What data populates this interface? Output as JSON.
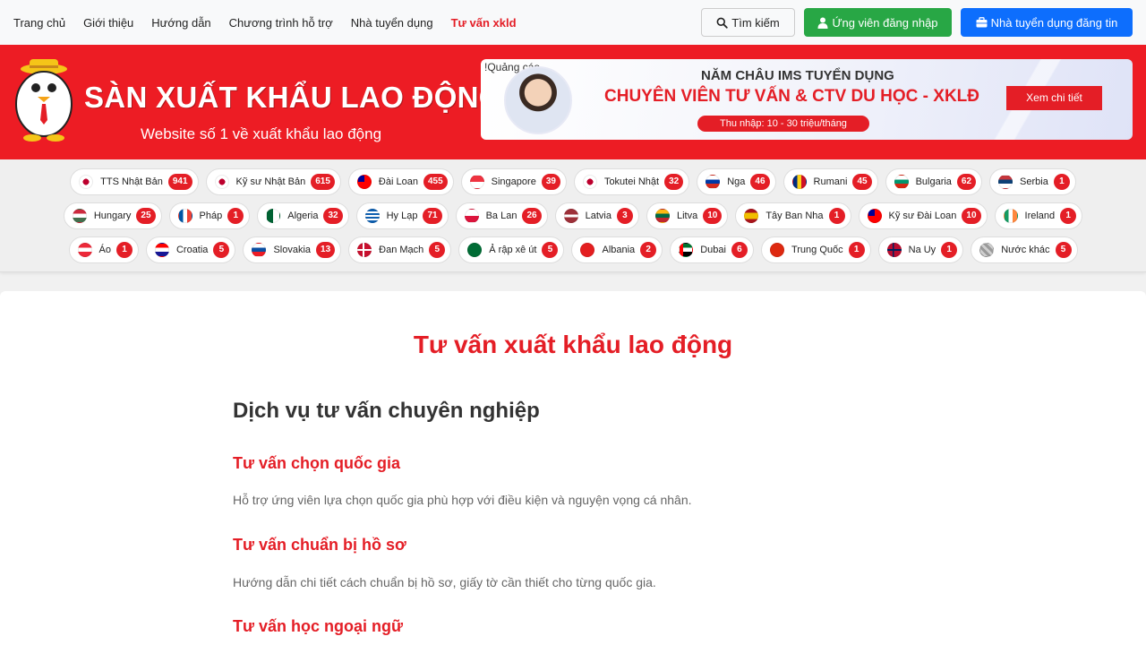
{
  "nav": {
    "links": [
      "Trang chủ",
      "Giới thiệu",
      "Hướng dẫn",
      "Chương trình hỗ trợ",
      "Nhà tuyển dụng",
      "Tư vấn xkld"
    ],
    "search_label": "Tìm kiếm",
    "candidate_login_label": "Ứng viên đăng nhập",
    "employer_post_label": "Nhà tuyển dụng đăng tin"
  },
  "brand": {
    "logo_text": "SÀN XUẤT KHẨU LAO ĐỘNG .COM",
    "tagline": "Website số 1 về xuất khẩu lao động",
    "primary_color": "#e41e26"
  },
  "ad": {
    "label": "!Quảng cáo",
    "title1": "NĂM CHÂU IMS TUYỂN DỤNG",
    "title2": "CHUYÊN VIÊN TƯ VẤN & CTV DU HỌC - XKLĐ",
    "income": "Thu nhập: 10 - 30 triệu/tháng",
    "cta": "Xem chi tiết"
  },
  "countries": [
    [
      {
        "name": "TTS Nhật Bản",
        "count": "941",
        "flag": "jp"
      },
      {
        "name": "Kỹ sư Nhật Bản",
        "count": "615",
        "flag": "jp"
      },
      {
        "name": "Đài Loan",
        "count": "455",
        "flag": "tw"
      },
      {
        "name": "Singapore",
        "count": "39",
        "flag": "sg"
      },
      {
        "name": "Tokutei Nhật",
        "count": "32",
        "flag": "jp"
      },
      {
        "name": "Nga",
        "count": "46",
        "flag": "ru"
      },
      {
        "name": "Rumani",
        "count": "45",
        "flag": "ro"
      },
      {
        "name": "Bulgaria",
        "count": "62",
        "flag": "bg"
      },
      {
        "name": "Serbia",
        "count": "1",
        "flag": "rs"
      }
    ],
    [
      {
        "name": "Hungary",
        "count": "25",
        "flag": "hu"
      },
      {
        "name": "Pháp",
        "count": "1",
        "flag": "fr"
      },
      {
        "name": "Algeria",
        "count": "32",
        "flag": "dz"
      },
      {
        "name": "Hy Lạp",
        "count": "71",
        "flag": "gr"
      },
      {
        "name": "Ba Lan",
        "count": "26",
        "flag": "pl"
      },
      {
        "name": "Latvia",
        "count": "3",
        "flag": "lv"
      },
      {
        "name": "Litva",
        "count": "10",
        "flag": "lt"
      },
      {
        "name": "Tây Ban Nha",
        "count": "1",
        "flag": "es"
      },
      {
        "name": "Kỹ sư Đài Loan",
        "count": "10",
        "flag": "tw"
      },
      {
        "name": "Ireland",
        "count": "1",
        "flag": "ie"
      }
    ],
    [
      {
        "name": "Áo",
        "count": "1",
        "flag": "at"
      },
      {
        "name": "Croatia",
        "count": "5",
        "flag": "hr"
      },
      {
        "name": "Slovakia",
        "count": "13",
        "flag": "sk"
      },
      {
        "name": "Đan Mạch",
        "count": "5",
        "flag": "dk"
      },
      {
        "name": "Ả rập xê út",
        "count": "5",
        "flag": "sa"
      },
      {
        "name": "Albania",
        "count": "2",
        "flag": "al"
      },
      {
        "name": "Dubai",
        "count": "6",
        "flag": "ae"
      },
      {
        "name": "Trung Quốc",
        "count": "1",
        "flag": "cn"
      },
      {
        "name": "Na Uy",
        "count": "1",
        "flag": "no"
      },
      {
        "name": "Nước khác",
        "count": "5",
        "flag": "other"
      }
    ]
  ],
  "content": {
    "page_title": "Tư vấn xuất khẩu lao động",
    "section_title": "Dịch vụ tư vấn chuyên nghiệp",
    "services": [
      {
        "title": "Tư vấn chọn quốc gia",
        "desc": "Hỗ trợ ứng viên lựa chọn quốc gia phù hợp với điều kiện và nguyện vọng cá nhân."
      },
      {
        "title": "Tư vấn chuẩn bị hồ sơ",
        "desc": "Hướng dẫn chi tiết cách chuẩn bị hồ sơ, giấy tờ cần thiết cho từng quốc gia."
      },
      {
        "title": "Tư vấn học ngoại ngữ",
        "desc": ""
      }
    ]
  }
}
